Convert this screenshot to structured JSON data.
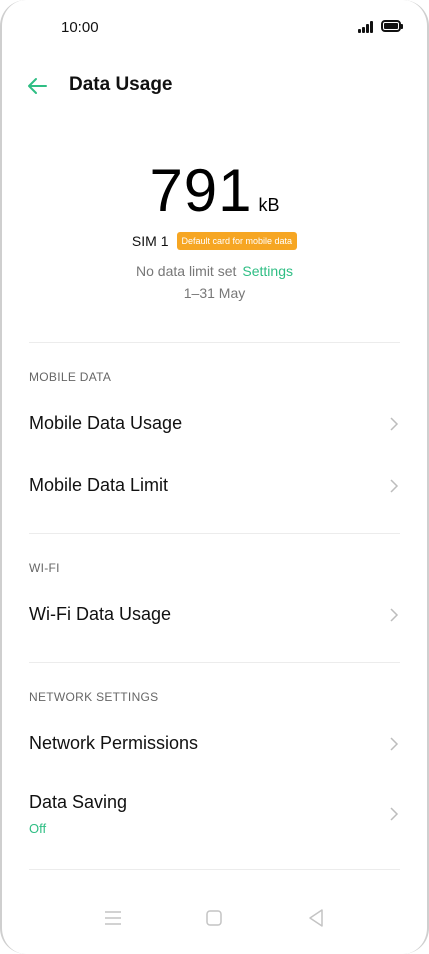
{
  "status_bar": {
    "time": "10:00",
    "signal_icon": "signal-icon",
    "battery_icon": "battery-icon"
  },
  "header": {
    "back_icon": "arrow-left-icon",
    "title": "Data Usage"
  },
  "usage": {
    "value": "791",
    "unit": "kB",
    "sim_label": "SIM 1",
    "sim_badge": "Default card for mobile data",
    "limit_text": "No data limit set",
    "settings_link": "Settings",
    "date_range": "1–31 May"
  },
  "sections": {
    "mobile_data": {
      "header": "MOBILE DATA",
      "items": [
        {
          "label": "Mobile Data Usage"
        },
        {
          "label": "Mobile Data Limit"
        }
      ]
    },
    "wifi": {
      "header": "WI-FI",
      "items": [
        {
          "label": "Wi-Fi Data Usage"
        }
      ]
    },
    "network_settings": {
      "header": "NETWORK SETTINGS",
      "items": [
        {
          "label": "Network Permissions"
        },
        {
          "label": "Data Saving",
          "sublabel": "Off"
        }
      ]
    }
  },
  "nav_bar": {
    "icons": [
      "menu-icon",
      "home-icon",
      "back-triangle-icon"
    ]
  },
  "colors": {
    "accent": "#2fbe84",
    "badge": "#f6a623",
    "text": "#111111",
    "secondary": "#777777"
  }
}
